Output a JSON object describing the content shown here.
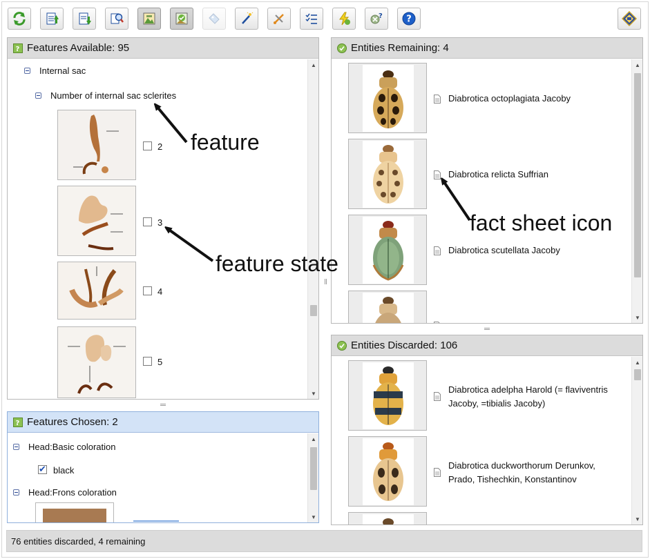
{
  "toolbar": {
    "buttons": [
      {
        "icon": "restart-icon"
      },
      {
        "icon": "upload-features-icon"
      },
      {
        "icon": "download-features-icon"
      },
      {
        "icon": "find-icon"
      },
      {
        "icon": "show-images-icon"
      },
      {
        "icon": "show-entity-images-icon"
      },
      {
        "icon": "tag-icon"
      },
      {
        "icon": "magic-wand-icon"
      },
      {
        "icon": "tools-icon"
      },
      {
        "icon": "checklist-icon"
      },
      {
        "icon": "lightning-icon"
      },
      {
        "icon": "unknown-state-icon"
      },
      {
        "icon": "help-icon"
      },
      {
        "icon": "lucid-logo-icon"
      }
    ]
  },
  "features_available": {
    "title": "Features Available: 95",
    "group": "Internal sac",
    "feature": "Number of internal sac sclerites",
    "states": [
      "2",
      "3",
      "4",
      "5"
    ]
  },
  "features_chosen": {
    "title": "Features Chosen: 2",
    "items": [
      {
        "label": "Head:Basic coloration",
        "state": "black"
      },
      {
        "label": "Head:Frons coloration"
      }
    ]
  },
  "entities_remaining": {
    "title": "Entities Remaining: 4",
    "entities": [
      "Diabrotica octoplagiata Jacoby",
      "Diabrotica relicta Suffrian",
      "Diabrotica scutellata Jacoby"
    ]
  },
  "entities_discarded": {
    "title": "Entities Discarded: 106",
    "entities": [
      {
        "line1": "Diabrotica adelpha Harold (= flaviventris",
        "line2": "Jacoby, =tibialis Jacoby)"
      },
      {
        "line1": "Diabrotica duckworthorum Derunkov,",
        "line2": "Prado, Tishechkin, Konstantinov"
      }
    ]
  },
  "status": "76 entities discarded, 4 remaining",
  "annotations": {
    "feature": "feature",
    "feature_state": "feature state",
    "fact_sheet_icon": "fact sheet icon"
  },
  "colors": {
    "header_gray": "#dcdcdc",
    "header_blue": "#d3e3f7",
    "check_green": "#7cb342",
    "help_blue": "#1d5fc8"
  }
}
